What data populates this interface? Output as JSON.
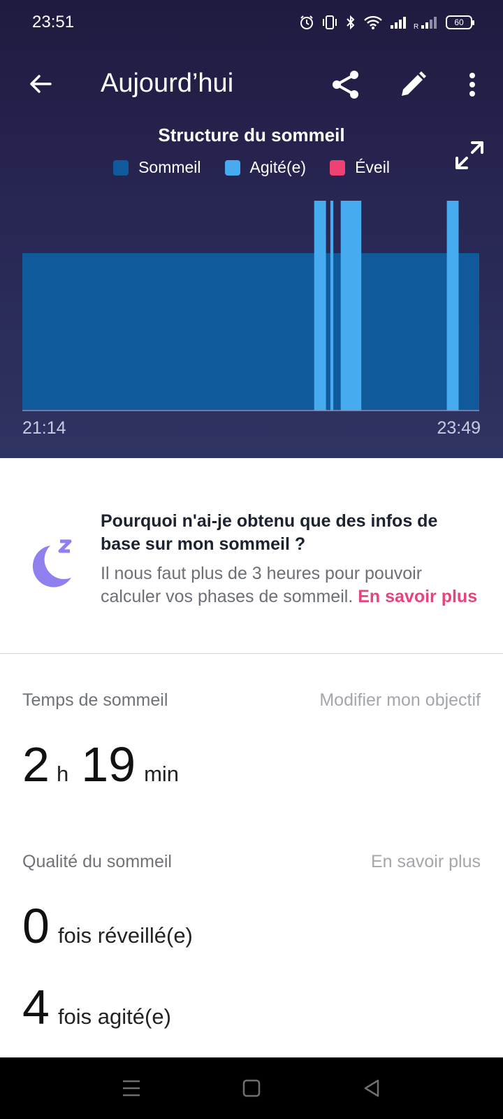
{
  "status": {
    "time": "23:51",
    "battery": "60"
  },
  "appbar": {
    "title": "Aujourd’hui"
  },
  "chart_title": "Structure du sommeil",
  "legend": [
    {
      "label": "Sommeil",
      "color": "#105a9c"
    },
    {
      "label": "Agité(e)",
      "color": "#46acef"
    },
    {
      "label": "Éveil",
      "color": "#ee4274"
    }
  ],
  "chart_data": {
    "type": "bar",
    "title": "Structure du sommeil",
    "x_start": "21:14",
    "x_end": "23:49",
    "x_unit": "minutes",
    "ylabels": [],
    "series": [
      {
        "name": "Sommeil",
        "color": "#105a9c",
        "level": 1,
        "segments": [
          [
            0,
            155
          ]
        ]
      },
      {
        "name": "Agité(e)",
        "color": "#46acef",
        "level": 2,
        "segments": [
          [
            99,
            103
          ],
          [
            104.5,
            105.5
          ],
          [
            108,
            115
          ],
          [
            144,
            148
          ]
        ]
      },
      {
        "name": "Éveil",
        "color": "#ee4274",
        "level": 3,
        "segments": []
      }
    ],
    "grid": false
  },
  "x_axis": {
    "start": "21:14",
    "end": "23:49"
  },
  "info": {
    "title": "Pourquoi n'ai-je obtenu que des infos de base sur mon sommeil ?",
    "body": "Il nous faut plus de 3 heures pour pouvoir calculer vos phases de sommeil. ",
    "link": "En savoir plus"
  },
  "sleep_time": {
    "label": "Temps de sommeil",
    "edit_goal": "Modifier mon objectif",
    "hours": "2",
    "hours_unit": "h",
    "minutes": "19",
    "minutes_unit": "min"
  },
  "quality": {
    "label": "Qualité du sommeil",
    "learn_more": "En savoir plus",
    "awake_count": "0",
    "awake_label": "fois réveillé(e)",
    "restless_count": "4",
    "restless_label": "fois agité(e)"
  }
}
